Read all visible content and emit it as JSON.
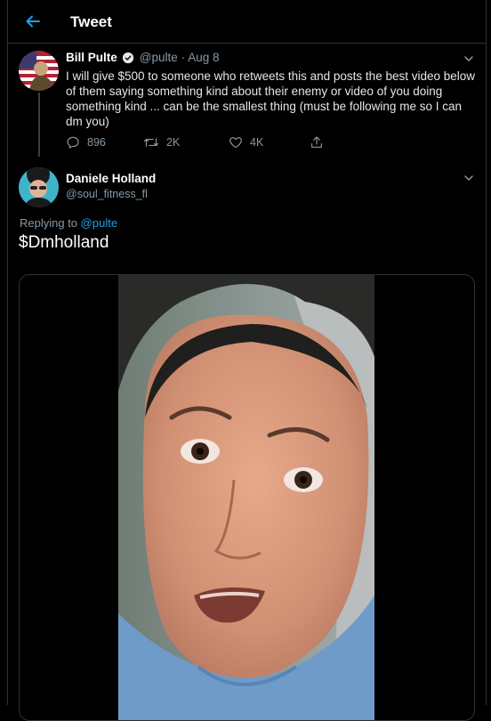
{
  "header": {
    "title": "Tweet",
    "back_icon": "arrow-left-icon",
    "accent": "#1da1f2"
  },
  "tweet": {
    "author_name": "Bill Pulte",
    "verified": true,
    "handle": "@pulte",
    "date": "· Aug 8",
    "text": "I will give $500 to someone who retweets this and posts the best video below of them saying something kind about their enemy or video of you doing something kind ... can be the smallest thing (must be following me so I can dm you)",
    "replies": "896",
    "retweets": "2K",
    "likes": "4K"
  },
  "reply": {
    "author_name": "Daniele Holland",
    "handle": "@soul_fitness_fl",
    "replying_prefix": "Replying to",
    "replying_to": "@pulte",
    "text": "$Dmholland"
  },
  "colors": {
    "background": "#000000",
    "border": "#2f3336",
    "muted": "#8899a6",
    "link": "#1da1f2"
  }
}
